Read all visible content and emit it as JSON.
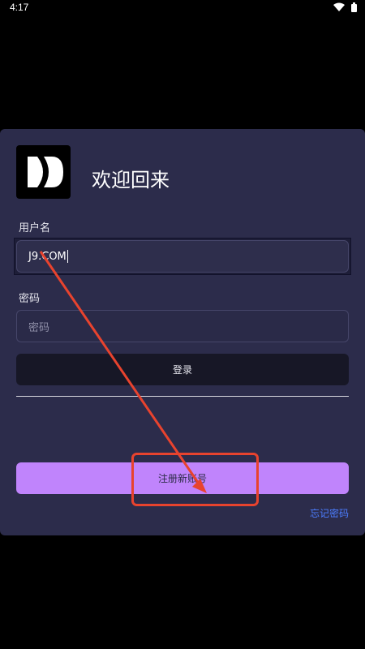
{
  "status_bar": {
    "time": "4:17"
  },
  "login": {
    "welcome": "欢迎回来",
    "username_label": "用户名",
    "username_value": "J9.COM",
    "password_label": "密码",
    "password_placeholder": "密码",
    "login_button": "登录",
    "register_button": "注册新账号",
    "forgot_password": "忘记密码"
  },
  "colors": {
    "card_bg": "#2c2c4b",
    "register_button_bg": "#c084fc",
    "login_button_bg": "#171726",
    "link": "#4c7dff",
    "annotation": "#e8432e"
  },
  "annotation": {
    "arrow-icon": "arrow-icon",
    "highlight": "highlight-box"
  }
}
